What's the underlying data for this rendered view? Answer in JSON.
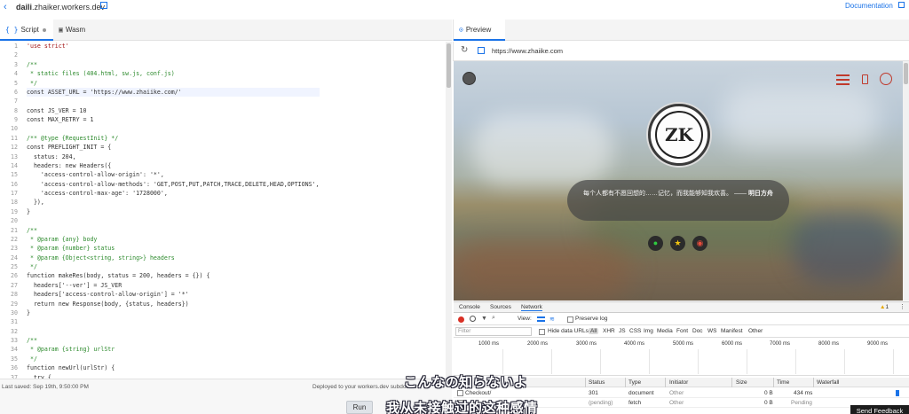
{
  "topbar": {
    "back_icon": "‹",
    "worker_name": "daili",
    "domain": ".zhaiker.workers.dev",
    "documentation": "Documentation"
  },
  "editor": {
    "tabs": [
      {
        "label": "Script",
        "icon": "{ }"
      },
      {
        "label": "Wasm",
        "icon": "▣"
      }
    ],
    "lines": [
      "'use strict'",
      "",
      "/**",
      " * static files (404.html, sw.js, conf.js)",
      " */",
      "const ASSET_URL = 'https://www.zhaiike.com/'",
      "",
      "const JS_VER = 10",
      "const MAX_RETRY = 1",
      "",
      "/** @type {RequestInit} */",
      "const PREFLIGHT_INIT = {",
      "  status: 204,",
      "  headers: new Headers({",
      "    'access-control-allow-origin': '*',",
      "    'access-control-allow-methods': 'GET,POST,PUT,PATCH,TRACE,DELETE,HEAD,OPTIONS',",
      "    'access-control-max-age': '1728000',",
      "  }),",
      "}",
      "",
      "/**",
      " * @param {any} body",
      " * @param {number} status",
      " * @param {Object<string, string>} headers",
      " */",
      "function makeRes(body, status = 200, headers = {}) {",
      "  headers['--ver'] = JS_VER",
      "  headers['access-control-allow-origin'] = '*'",
      "  return new Response(body, {status, headers})",
      "}",
      "",
      "",
      "/**",
      " * @param {string} urlStr",
      " */",
      "function newUrl(urlStr) {",
      "  try {"
    ],
    "status_saved": "Last saved: Sep 19th, 9:50:00 PM",
    "status_deployed": "Deployed to your workers.dev subdomain",
    "run_label": "Run"
  },
  "preview": {
    "tab_label": "Preview",
    "tab_icon": "⊙",
    "url": "https://www.zhaiike.com",
    "site": {
      "avatar_text": "ZK",
      "quote_text": "每个人都有不愿回想的……记忆，而我能够知我欢喜。 —— ",
      "quote_author": "明日方舟",
      "icons": [
        "wechat-icon",
        "star-icon",
        "weibo-icon"
      ]
    }
  },
  "devtools": {
    "tabs": [
      "Console",
      "Sources",
      "Network"
    ],
    "warning_count": "1",
    "view_label": "View:",
    "preserve_log": "Preserve log",
    "filter_placeholder": "Filter",
    "hide_data_urls": "Hide data URLs",
    "type_filters": [
      "All",
      "XHR",
      "JS",
      "CSS",
      "Img",
      "Media",
      "Font",
      "Doc",
      "WS",
      "Manifest",
      "Other"
    ],
    "ticks": [
      "1000 ms",
      "2000 ms",
      "3000 ms",
      "4000 ms",
      "5000 ms",
      "6000 ms",
      "7000 ms",
      "8000 ms",
      "9000 ms"
    ],
    "columns": [
      "Status",
      "Type",
      "Initiator",
      "Size",
      "Time",
      "Waterfall"
    ],
    "rows": [
      {
        "name": "Checkout/",
        "status": "301",
        "type": "document",
        "initiator": "Other",
        "size": "0 B",
        "time": "434 ms"
      },
      {
        "name": "",
        "status": "(pending)",
        "type": "fetch",
        "initiator": "Other",
        "size": "0 B",
        "time": "Pending"
      }
    ]
  },
  "subtitles": {
    "line1": "こんなの知らないよ",
    "line2": "我从未接触过的这种感情"
  },
  "feedback_label": "Send Feedback"
}
